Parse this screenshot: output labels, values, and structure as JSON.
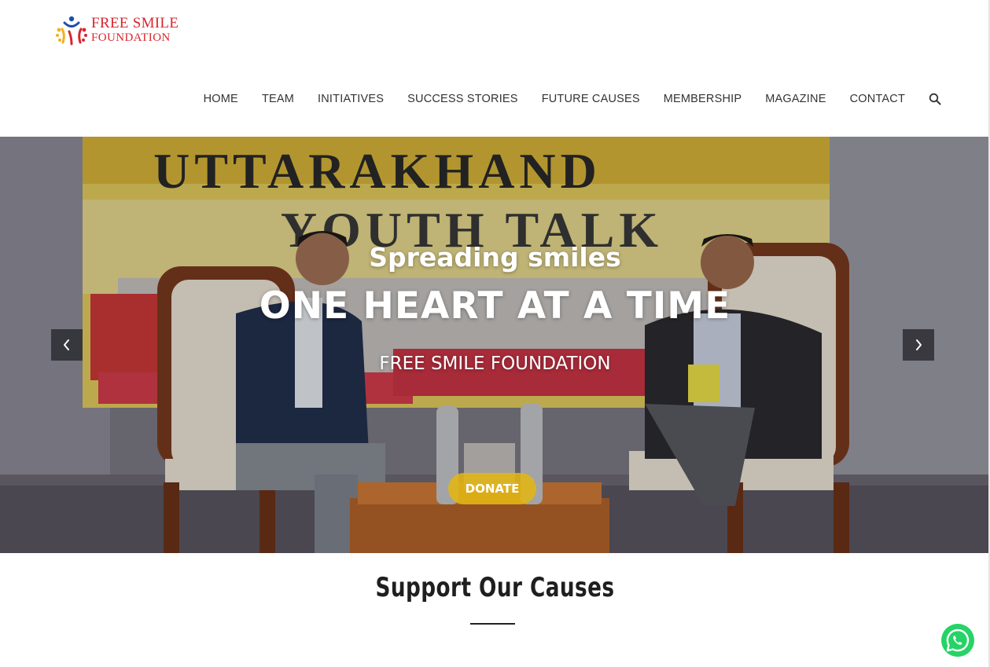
{
  "logo": {
    "line1": "FREE SMILE",
    "line2": "FOUNDATION",
    "brand_color": "#d7262e"
  },
  "nav": {
    "items": [
      {
        "label": "HOME"
      },
      {
        "label": "TEAM"
      },
      {
        "label": "INITIATIVES"
      },
      {
        "label": "SUCCESS STORIES"
      },
      {
        "label": "FUTURE CAUSES"
      },
      {
        "label": "MEMBERSHIP"
      },
      {
        "label": "MAGAZINE"
      },
      {
        "label": "CONTACT"
      }
    ],
    "search_icon": "search-icon"
  },
  "hero": {
    "subtitle": "Spreading smiles",
    "title": "ONE HEART AT A TIME",
    "org": "FREE SMILE FOUNDATION",
    "donate_label": "DONATE",
    "banner_line1": "UTTARAKHAND",
    "banner_line2": "YOUTH TALK",
    "prev_icon": "chevron-left-icon",
    "next_icon": "chevron-right-icon",
    "donate_color": "#e2b614"
  },
  "causes": {
    "title": "Support Our Causes"
  },
  "whatsapp": {
    "icon": "whatsapp-icon",
    "color": "#25d366"
  }
}
